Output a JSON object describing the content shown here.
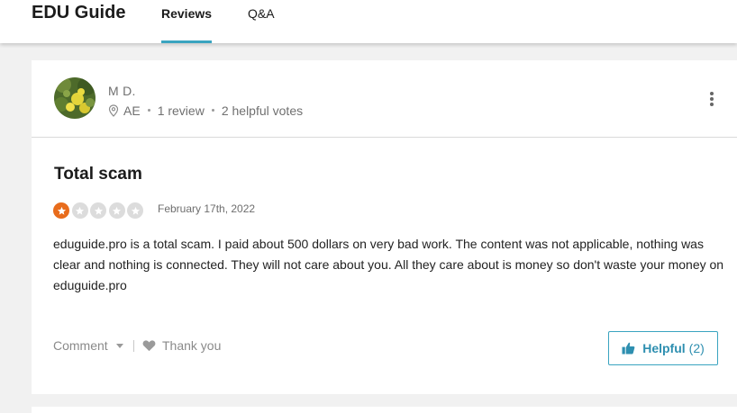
{
  "header": {
    "brand": "EDU Guide",
    "tabs": [
      {
        "label": "Reviews",
        "active": true
      },
      {
        "label": "Q&A",
        "active": false
      }
    ],
    "accent_color": "#3aa4c0"
  },
  "review": {
    "user": {
      "name": "M D.",
      "location": "AE",
      "review_count": "1 review",
      "helpful_votes": "2 helpful votes",
      "location_icon": "map-pin-icon",
      "menu_icon": "more-vertical-icon"
    },
    "title": "Total scam",
    "rating": 1,
    "max_rating": 5,
    "star_color": "#e86c1c",
    "date": "February 17th, 2022",
    "body": "eduguide.pro is a total scam. I paid about 500 dollars on very bad work. The content was not applicable, nothing was clear and nothing is connected. They will not care about you. All they care about is money so don't waste your money on eduguide.pro",
    "actions": {
      "comment_label": "Comment",
      "thank_label": "Thank you",
      "helpful_label": "Helpful",
      "helpful_count": "(2)"
    }
  }
}
